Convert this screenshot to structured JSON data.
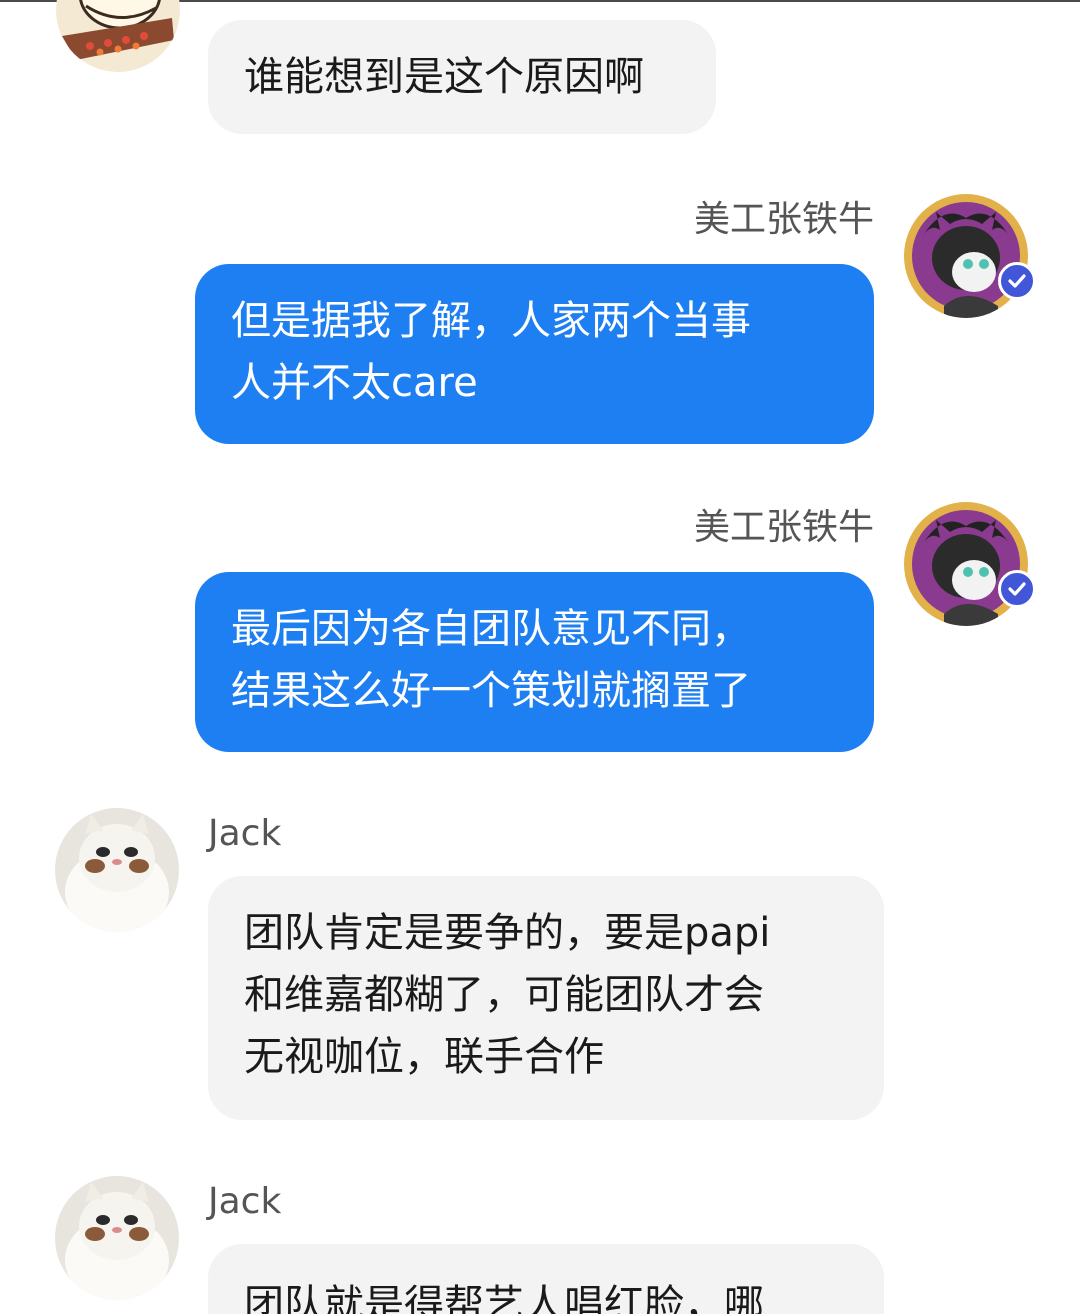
{
  "messages": [
    {
      "id": 1,
      "direction": "incoming",
      "sender": "",
      "avatar_icon": "cartoon-cook-avatar-icon",
      "text": "谁能想到是这个原因啊"
    },
    {
      "id": 2,
      "direction": "outgoing",
      "sender": "美工张铁牛",
      "avatar_icon": "horned-character-avatar-icon",
      "verified": true,
      "text": "但是据我了解，人家两个当事\n人并不太care"
    },
    {
      "id": 3,
      "direction": "outgoing",
      "sender": "美工张铁牛",
      "avatar_icon": "horned-character-avatar-icon",
      "verified": true,
      "text": "最后因为各自团队意见不同，\n结果这么好一个策划就搁置了"
    },
    {
      "id": 4,
      "direction": "incoming",
      "sender": "Jack",
      "avatar_icon": "white-cat-avatar-icon",
      "text": "团队肯定是要争的，要是papi\n和维嘉都糊了，可能团队才会\n无视咖位，联手合作"
    },
    {
      "id": 5,
      "direction": "incoming",
      "sender": "Jack",
      "avatar_icon": "white-cat-avatar-icon",
      "text": "团队就是得帮艺人唱红脸，哪"
    }
  ],
  "colors": {
    "outgoing_bubble": "#1d7ff2",
    "incoming_bubble": "#f3f3f3",
    "verify_badge": "#4257d8"
  }
}
